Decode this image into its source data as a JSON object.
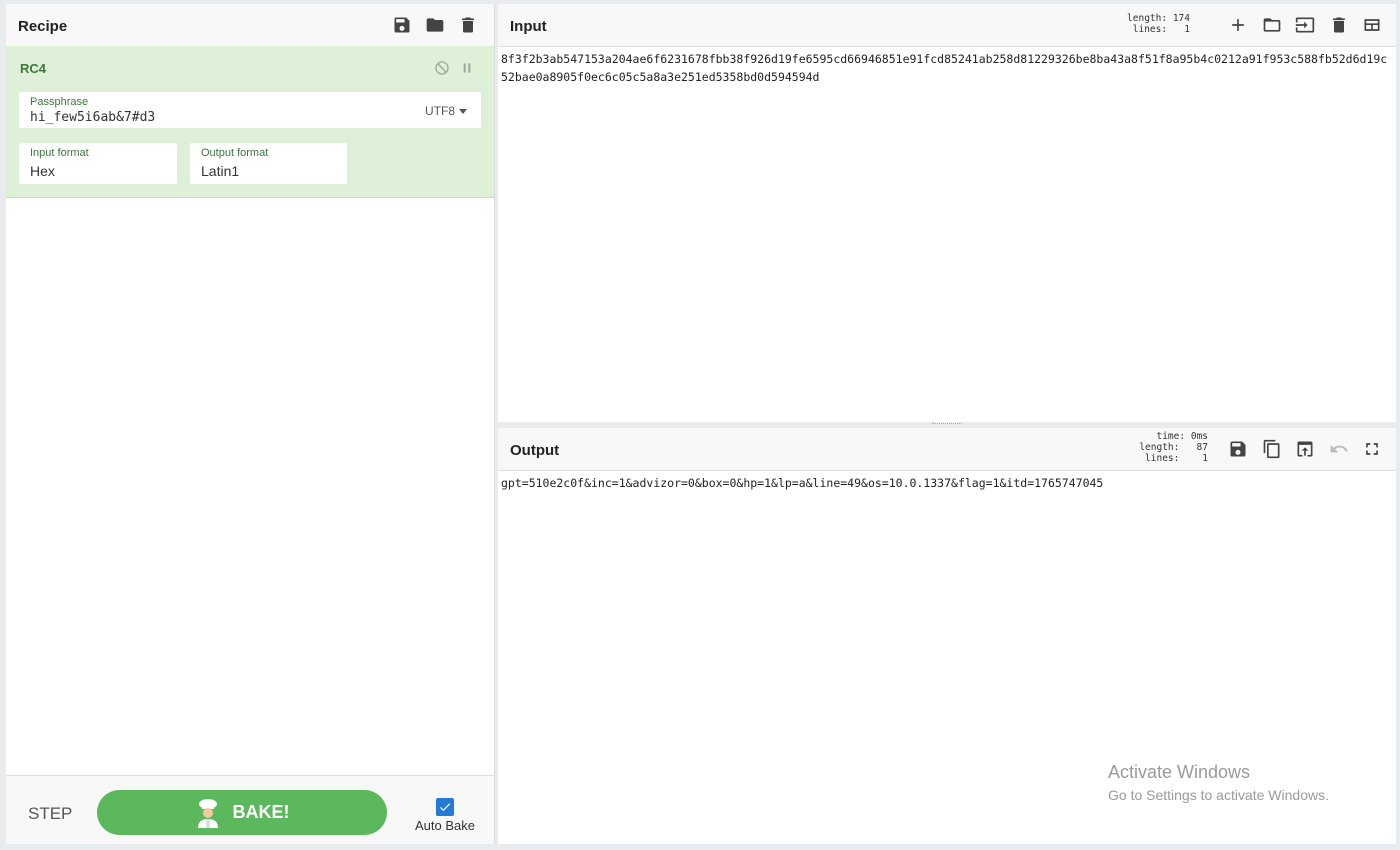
{
  "recipe": {
    "title": "Recipe",
    "operation": {
      "name": "RC4",
      "passphrase_label": "Passphrase",
      "passphrase_value": "hi_few5i6ab&7#d3",
      "passphrase_encoding": "UTF8",
      "input_format_label": "Input format",
      "input_format_value": "Hex",
      "output_format_label": "Output format",
      "output_format_value": "Latin1"
    },
    "step_label": "STEP",
    "bake_label": "BAKE!",
    "auto_bake_label": "Auto Bake",
    "auto_bake_checked": true
  },
  "input": {
    "title": "Input",
    "length_label": "length:",
    "length_value": "174",
    "lines_label": "lines:",
    "lines_value": "1",
    "text": "8f3f2b3ab547153a204ae6f6231678fbb38f926d19fe6595cd66946851e91fcd85241ab258d81229326be8ba43a8f51f8a95b4c0212a91f953c588fb52d6d19c52bae0a8905f0ec6c05c5a8a3e251ed5358bd0d594594d"
  },
  "output": {
    "title": "Output",
    "time_label": "time:",
    "time_value": "0ms",
    "length_label": "length:",
    "length_value": "87",
    "lines_label": "lines:",
    "lines_value": "1",
    "text": "gpt=510e2c0f&inc=1&advizor=0&box=0&hp=1&lp=a&line=49&os=10.0.1337&flag=1&itd=1765747045"
  },
  "watermark": {
    "line1": "Activate Windows",
    "line2": "Go to Settings to activate Windows."
  },
  "colors": {
    "bake_green": "#5cb85c",
    "operation_bg": "#dff0d8",
    "checkbox_blue": "#2579d7"
  }
}
